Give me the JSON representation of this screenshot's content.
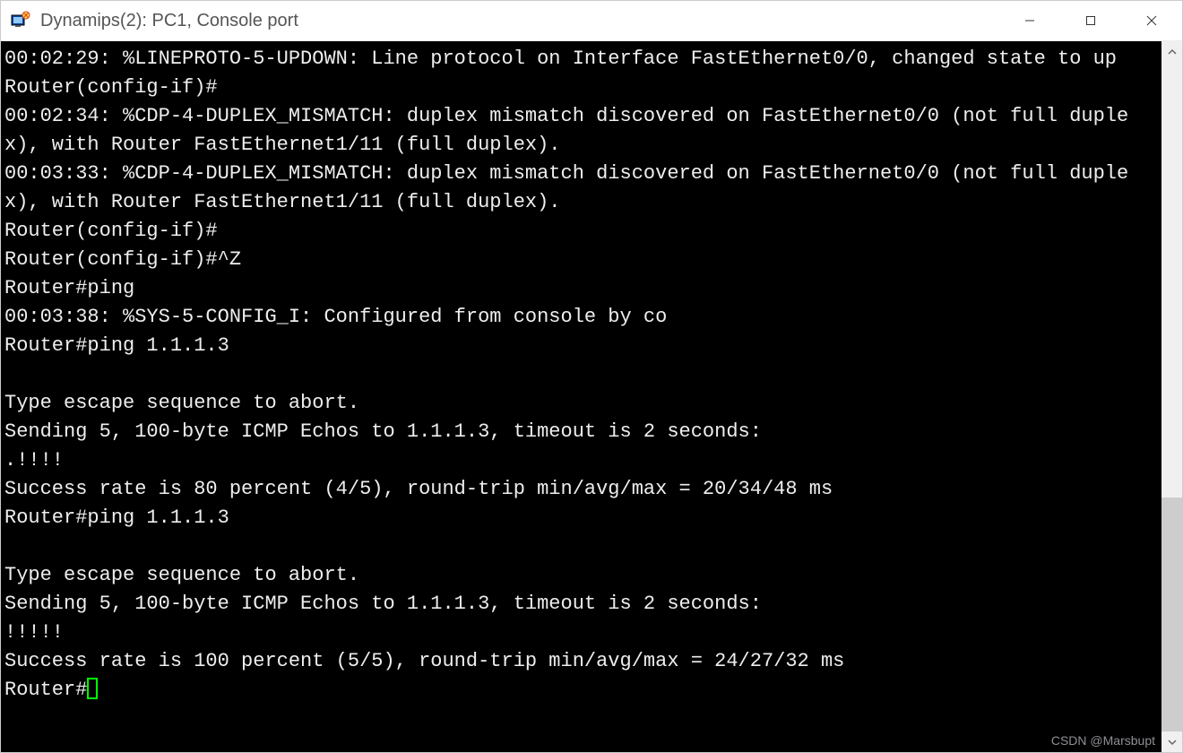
{
  "window": {
    "title": "Dynamips(2): PC1, Console port"
  },
  "terminal": {
    "lines": [
      "00:02:29: %LINEPROTO-5-UPDOWN: Line protocol on Interface FastEthernet0/0, changed state to up",
      "Router(config-if)#",
      "00:02:34: %CDP-4-DUPLEX_MISMATCH: duplex mismatch discovered on FastEthernet0/0 (not full duplex), with Router FastEthernet1/11 (full duplex).",
      "00:03:33: %CDP-4-DUPLEX_MISMATCH: duplex mismatch discovered on FastEthernet0/0 (not full duplex), with Router FastEthernet1/11 (full duplex).",
      "Router(config-if)#",
      "Router(config-if)#^Z",
      "Router#ping",
      "00:03:38: %SYS-5-CONFIG_I: Configured from console by co",
      "Router#ping 1.1.1.3",
      "",
      "Type escape sequence to abort.",
      "Sending 5, 100-byte ICMP Echos to 1.1.1.3, timeout is 2 seconds:",
      ".!!!!",
      "Success rate is 80 percent (4/5), round-trip min/avg/max = 20/34/48 ms",
      "Router#ping 1.1.1.3",
      "",
      "Type escape sequence to abort.",
      "Sending 5, 100-byte ICMP Echos to 1.1.1.3, timeout is 2 seconds:",
      "!!!!!",
      "Success rate is 100 percent (5/5), round-trip min/avg/max = 24/27/32 ms"
    ],
    "prompt": "Router#"
  },
  "scrollbar": {
    "thumb_top_pct": 65,
    "thumb_height_pct": 35
  },
  "watermark": "CSDN @Marsbupt"
}
